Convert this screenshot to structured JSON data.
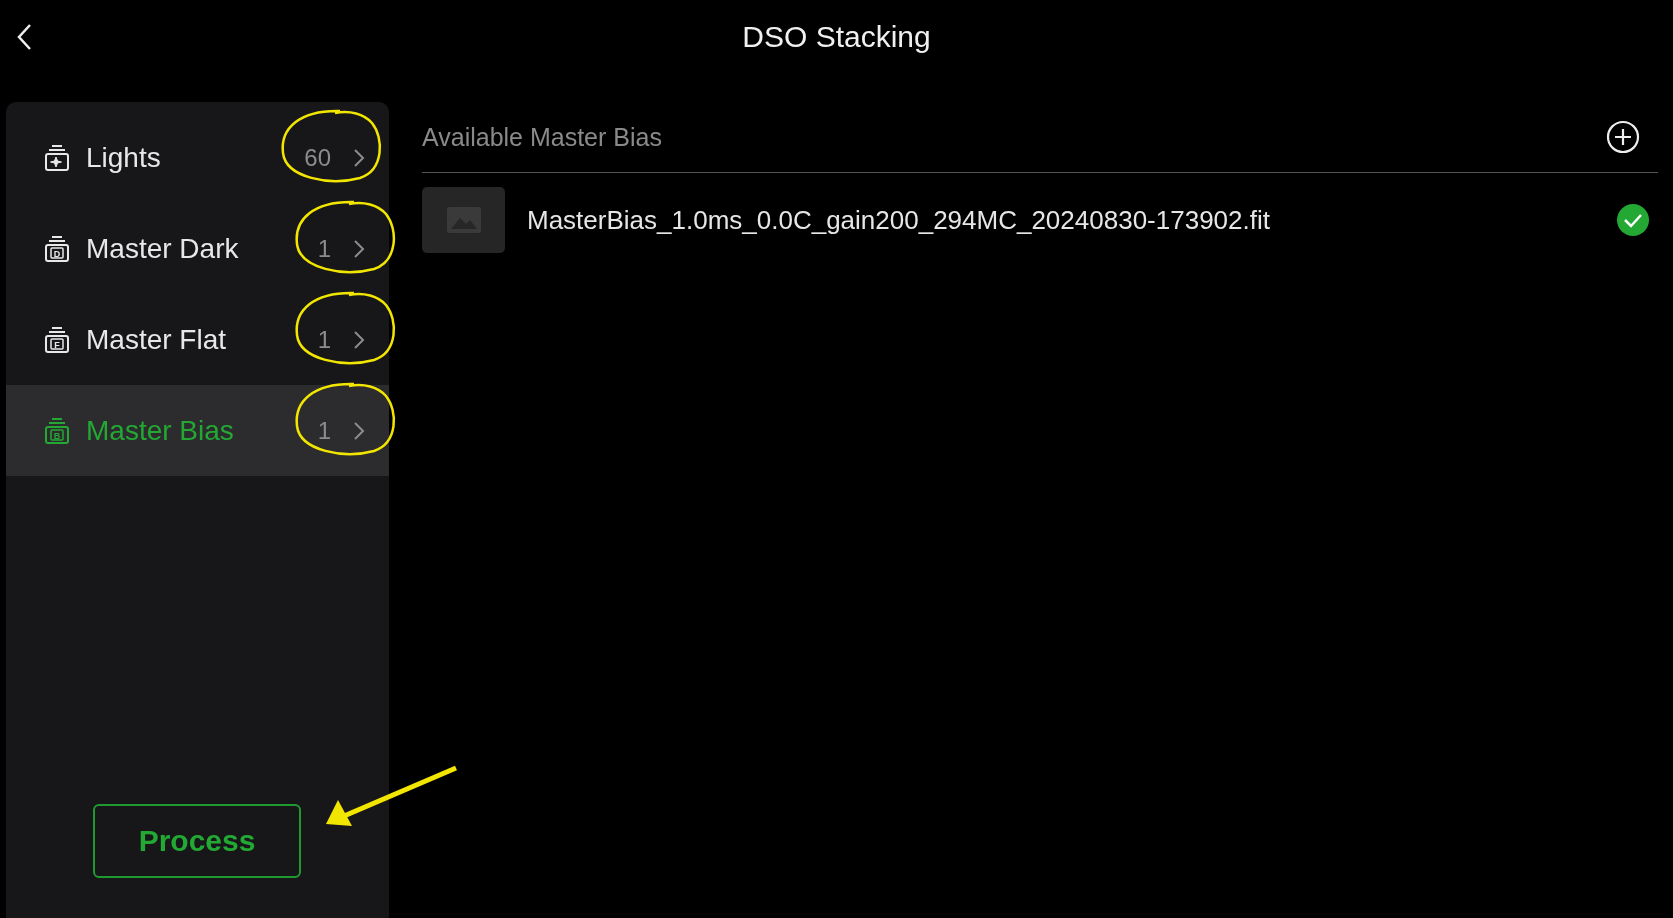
{
  "header": {
    "title": "DSO Stacking"
  },
  "sidebar": {
    "items": [
      {
        "label": "Lights",
        "count": "60",
        "selected": false,
        "circled": true
      },
      {
        "label": "Master Dark",
        "count": "1",
        "icon_letter": "D",
        "selected": false,
        "circled": true
      },
      {
        "label": "Master Flat",
        "count": "1",
        "icon_letter": "F",
        "selected": false,
        "circled": true
      },
      {
        "label": "Master Bias",
        "count": "1",
        "icon_letter": "B",
        "selected": true,
        "circled": true
      }
    ],
    "process_button": {
      "label": "Process",
      "arrow_pointed": true
    }
  },
  "panel": {
    "heading": "Available Master Bias",
    "files": [
      {
        "name": "MasterBias_1.0ms_0.0C_gain200_294MC_20240830-173902.fit",
        "checked": true
      }
    ]
  }
}
